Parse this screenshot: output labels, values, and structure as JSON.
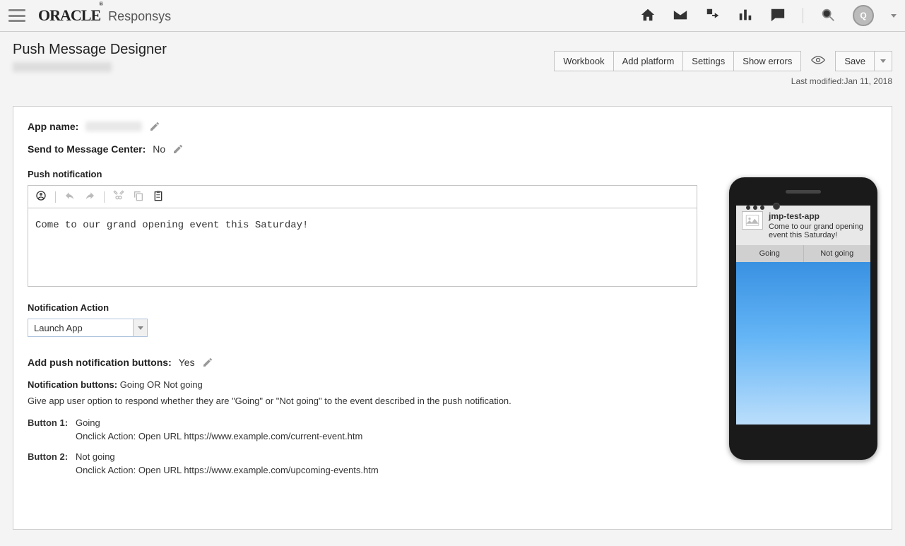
{
  "brand": {
    "logo": "ORACLE",
    "sub": "Responsys"
  },
  "page_title": "Push Message Designer",
  "actions": {
    "workbook": "Workbook",
    "add_platform": "Add platform",
    "settings": "Settings",
    "show_errors": "Show errors",
    "save": "Save"
  },
  "last_modified": "Last modified:Jan 11, 2018",
  "fields": {
    "app_name_label": "App name:",
    "send_mc_label": "Send to Message Center:",
    "send_mc_value": "No",
    "push_notification_label": "Push notification",
    "notification_body": "Come to our grand opening event this Saturday!",
    "notif_action_label": "Notification Action",
    "notif_action_value": "Launch App",
    "add_buttons_label": "Add push notification buttons:",
    "add_buttons_value": "Yes",
    "notif_buttons_label": "Notification buttons:",
    "notif_buttons_value": "Going OR Not going",
    "notif_buttons_desc": "Give app user option to respond whether they are \"Going\" or \"Not going\" to the event described in the push notification.",
    "button1_label": "Button 1:",
    "button1_value": "Going",
    "button1_action": "Onclick Action: Open URL  https://www.example.com/current-event.htm",
    "button2_label": "Button 2:",
    "button2_value": "Not going",
    "button2_action": "Onclick Action: Open URL  https://www.example.com/upcoming-events.htm"
  },
  "preview": {
    "app_title": "jmp-test-app",
    "body": "Come to our grand opening event this Saturday!",
    "btn1": "Going",
    "btn2": "Not going"
  },
  "avatar_initial": "Q"
}
